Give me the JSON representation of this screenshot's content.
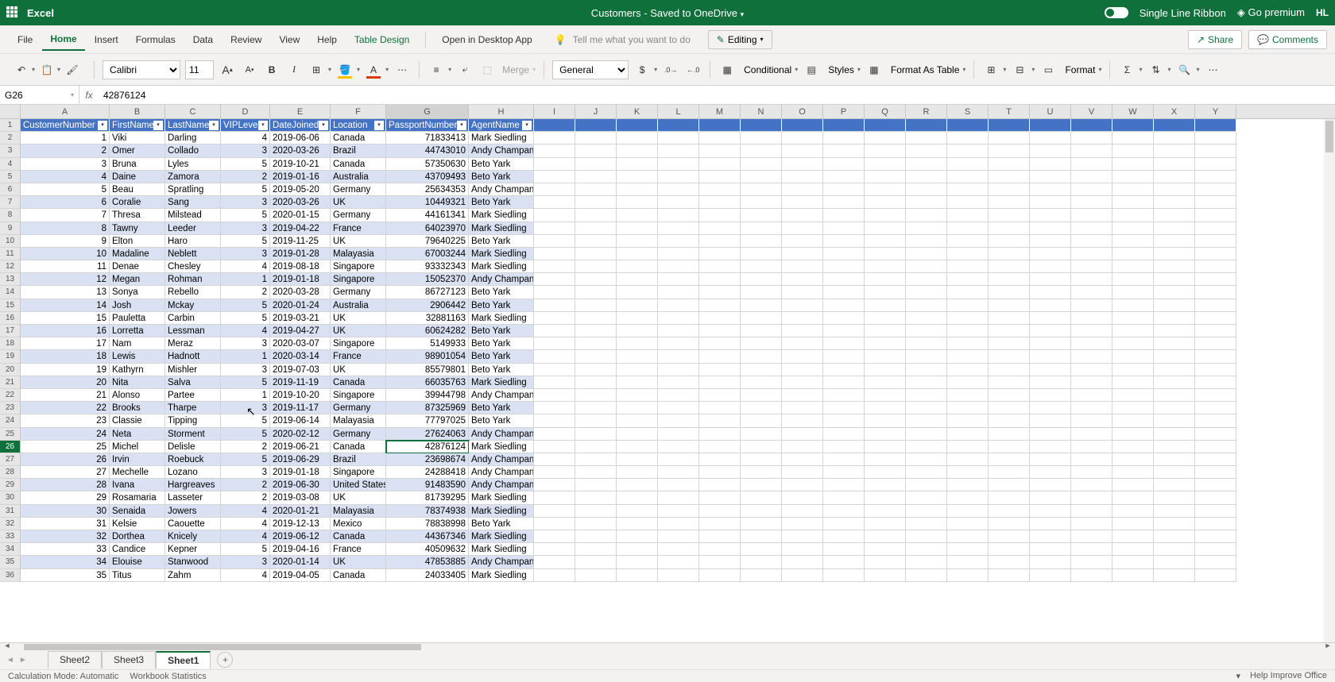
{
  "titlebar": {
    "app": "Excel",
    "doc": "Customers - Saved to OneDrive",
    "single_line": "Single Line Ribbon",
    "premium": "Go premium",
    "user": "HL"
  },
  "tabs": {
    "file": "File",
    "home": "Home",
    "insert": "Insert",
    "formulas": "Formulas",
    "data": "Data",
    "review": "Review",
    "view": "View",
    "help": "Help",
    "table_design": "Table Design",
    "open_desktop": "Open in Desktop App",
    "tell_me": "Tell me what you want to do",
    "editing": "Editing",
    "share": "Share",
    "comments": "Comments"
  },
  "toolbar": {
    "font_name": "Calibri",
    "font_size": "11",
    "merge": "Merge",
    "num_format": "General",
    "conditional": "Conditional",
    "styles": "Styles",
    "format_table": "Format As Table",
    "format": "Format"
  },
  "namebox": "G26",
  "formula": "42876124",
  "columns": [
    "A",
    "B",
    "C",
    "D",
    "E",
    "F",
    "G",
    "H",
    "I",
    "J",
    "K",
    "L",
    "M",
    "N",
    "O",
    "P",
    "Q",
    "R",
    "S",
    "T",
    "U",
    "V",
    "W",
    "X",
    "Y"
  ],
  "headers": [
    "CustomerNumber",
    "FirstName",
    "LastName",
    "VIPLevel",
    "DateJoined",
    "Location",
    "PassportNumber",
    "AgentName"
  ],
  "active_cell": {
    "row": 26,
    "col": "G"
  },
  "rows": [
    [
      1,
      "Viki",
      "Darling",
      4,
      "2019-06-06",
      "Canada",
      71833413,
      "Mark Siedling"
    ],
    [
      2,
      "Omer",
      "Collado",
      3,
      "2020-03-26",
      "Brazil",
      44743010,
      "Andy Champan"
    ],
    [
      3,
      "Bruna",
      "Lyles",
      5,
      "2019-10-21",
      "Canada",
      57350630,
      "Beto Yark"
    ],
    [
      4,
      "Daine",
      "Zamora",
      2,
      "2019-01-16",
      "Australia",
      43709493,
      "Beto Yark"
    ],
    [
      5,
      "Beau",
      "Spratling",
      5,
      "2019-05-20",
      "Germany",
      25634353,
      "Andy Champan"
    ],
    [
      6,
      "Coralie",
      "Sang",
      3,
      "2020-03-26",
      "UK",
      10449321,
      "Beto Yark"
    ],
    [
      7,
      "Thresa",
      "Milstead",
      5,
      "2020-01-15",
      "Germany",
      44161341,
      "Mark Siedling"
    ],
    [
      8,
      "Tawny",
      "Leeder",
      3,
      "2019-04-22",
      "France",
      64023970,
      "Mark Siedling"
    ],
    [
      9,
      "Elton",
      "Haro",
      5,
      "2019-11-25",
      "UK",
      79640225,
      "Beto Yark"
    ],
    [
      10,
      "Madaline",
      "Neblett",
      3,
      "2019-01-28",
      "Malayasia",
      67003244,
      "Mark Siedling"
    ],
    [
      11,
      "Denae",
      "Chesley",
      4,
      "2019-08-18",
      "Singapore",
      93332343,
      "Mark Siedling"
    ],
    [
      12,
      "Megan",
      "Rohman",
      1,
      "2019-01-18",
      "Singapore",
      15052370,
      "Andy Champan"
    ],
    [
      13,
      "Sonya",
      "Rebello",
      2,
      "2020-03-28",
      "Germany",
      86727123,
      "Beto Yark"
    ],
    [
      14,
      "Josh",
      "Mckay",
      5,
      "2020-01-24",
      "Australia",
      2906442,
      "Beto Yark"
    ],
    [
      15,
      "Pauletta",
      "Carbin",
      5,
      "2019-03-21",
      "UK",
      32881163,
      "Mark Siedling"
    ],
    [
      16,
      "Lorretta",
      "Lessman",
      4,
      "2019-04-27",
      "UK",
      60624282,
      "Beto Yark"
    ],
    [
      17,
      "Nam",
      "Meraz",
      3,
      "2020-03-07",
      "Singapore",
      5149933,
      "Beto Yark"
    ],
    [
      18,
      "Lewis",
      "Hadnott",
      1,
      "2020-03-14",
      "France",
      98901054,
      "Beto Yark"
    ],
    [
      19,
      "Kathyrn",
      "Mishler",
      3,
      "2019-07-03",
      "UK",
      85579801,
      "Beto Yark"
    ],
    [
      20,
      "Nita",
      "Salva",
      5,
      "2019-11-19",
      "Canada",
      66035763,
      "Mark Siedling"
    ],
    [
      21,
      "Alonso",
      "Partee",
      1,
      "2019-10-20",
      "Singapore",
      39944798,
      "Andy Champan"
    ],
    [
      22,
      "Brooks",
      "Tharpe",
      3,
      "2019-11-17",
      "Germany",
      87325969,
      "Beto Yark"
    ],
    [
      23,
      "Classie",
      "Tipping",
      5,
      "2019-06-14",
      "Malayasia",
      77797025,
      "Beto Yark"
    ],
    [
      24,
      "Neta",
      "Storment",
      5,
      "2020-02-12",
      "Germany",
      27624063,
      "Andy Champan"
    ],
    [
      25,
      "Michel",
      "Delisle",
      2,
      "2019-06-21",
      "Canada",
      42876124,
      "Mark Siedling"
    ],
    [
      26,
      "Irvin",
      "Roebuck",
      5,
      "2019-06-29",
      "Brazil",
      23698674,
      "Andy Champan"
    ],
    [
      27,
      "Mechelle",
      "Lozano",
      3,
      "2019-01-18",
      "Singapore",
      24288418,
      "Andy Champan"
    ],
    [
      28,
      "Ivana",
      "Hargreaves",
      2,
      "2019-06-30",
      "United States",
      91483590,
      "Andy Champan"
    ],
    [
      29,
      "Rosamaria",
      "Lasseter",
      2,
      "2019-03-08",
      "UK",
      81739295,
      "Mark Siedling"
    ],
    [
      30,
      "Senaida",
      "Jowers",
      4,
      "2020-01-21",
      "Malayasia",
      78374938,
      "Mark Siedling"
    ],
    [
      31,
      "Kelsie",
      "Caouette",
      4,
      "2019-12-13",
      "Mexico",
      78838998,
      "Beto Yark"
    ],
    [
      32,
      "Dorthea",
      "Knicely",
      4,
      "2019-06-12",
      "Canada",
      44367346,
      "Mark Siedling"
    ],
    [
      33,
      "Candice",
      "Kepner",
      5,
      "2019-04-16",
      "France",
      40509632,
      "Mark Siedling"
    ],
    [
      34,
      "Elouise",
      "Stanwood",
      3,
      "2020-01-14",
      "UK",
      47853885,
      "Andy Champan"
    ],
    [
      35,
      "Titus",
      "Zahm",
      4,
      "2019-04-05",
      "Canada",
      24033405,
      "Mark Siedling"
    ]
  ],
  "sheets": [
    "Sheet2",
    "Sheet3",
    "Sheet1"
  ],
  "active_sheet": 2,
  "status": {
    "calc": "Calculation Mode: Automatic",
    "stats": "Workbook Statistics",
    "help": "Help Improve Office"
  }
}
